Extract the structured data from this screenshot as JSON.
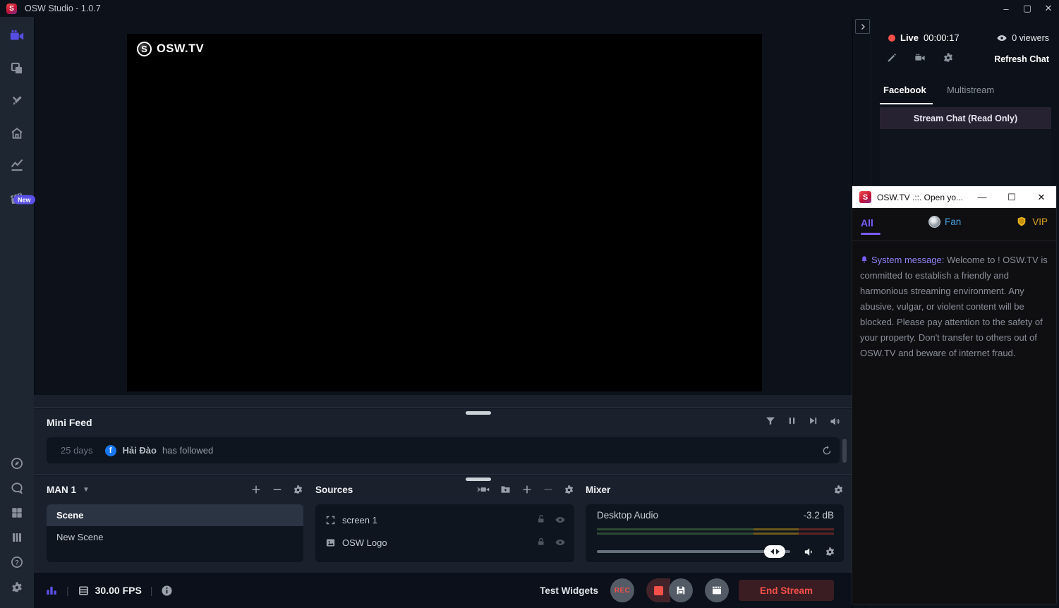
{
  "titlebar": {
    "title": "OSW Studio - 1.0.7",
    "app_initial": "S"
  },
  "sidebar": {
    "new_badge": "New"
  },
  "preview": {
    "watermark_initial": "S",
    "watermark": "OSW.TV"
  },
  "live": {
    "label": "Live",
    "timer": "00:00:17",
    "viewers": "0 viewers",
    "refresh": "Refresh Chat"
  },
  "tabs": {
    "facebook": "Facebook",
    "multistream": "Multistream"
  },
  "stream_chat": {
    "header": "Stream Chat (Read Only)"
  },
  "mini_feed": {
    "title": "Mini Feed",
    "event": {
      "age": "25 days",
      "user": "Hải Đào",
      "action": "has followed"
    }
  },
  "scenes": {
    "collection": "MAN 1",
    "items": [
      "Scene",
      "New Scene"
    ],
    "selected_index": 0
  },
  "sources": {
    "title": "Sources",
    "items": [
      "screen 1",
      "OSW Logo"
    ]
  },
  "mixer": {
    "title": "Mixer",
    "channel": "Desktop Audio",
    "db": "-3.2 dB",
    "meter": {
      "green_pct": 66,
      "yellow_pct": 19,
      "red_pct": 15
    },
    "volume_pct": 92
  },
  "status": {
    "fps": "30.00 FPS",
    "test_widgets": "Test Widgets",
    "rec": "REC",
    "end_stream": "End Stream"
  },
  "popup": {
    "title": "OSW.TV .::. Open yo...",
    "app_initial": "S",
    "tabs": {
      "all": "All",
      "fan": "Fan",
      "vip": "VIP"
    },
    "message": {
      "label": "System message:",
      "body": " Welcome to ! OSW.TV is committed to establish a friendly and harmonious streaming environment. Any abusive, vulgar, or violent content will be blocked. Please pay attention to the safety of your property. Don't transfer to others out of OSW.TV and beware of internet fraud."
    }
  },
  "icons": {
    "sidebar_top": [
      "editor-camera",
      "scene-collections",
      "widgets",
      "store",
      "dashboard",
      "highlights"
    ],
    "sidebar_bottom": [
      "browse",
      "chat",
      "layout-grid",
      "columns",
      "help",
      "settings"
    ],
    "mini_feed": [
      "filter",
      "pause",
      "skip-to-end",
      "mute-feed"
    ],
    "sources_header": [
      "audio-camera",
      "add-folder",
      "add",
      "remove",
      "settings"
    ],
    "source_row": [
      "screen-capture",
      "image",
      "lock",
      "unlock",
      "visibility-eye"
    ]
  },
  "colors": {
    "accent_purple": "#7a5cff",
    "live_red": "#f4504a",
    "fan_blue": "#4aa0e0",
    "vip_gold": "#d8a21d",
    "message_purple": "#8f83f3"
  }
}
